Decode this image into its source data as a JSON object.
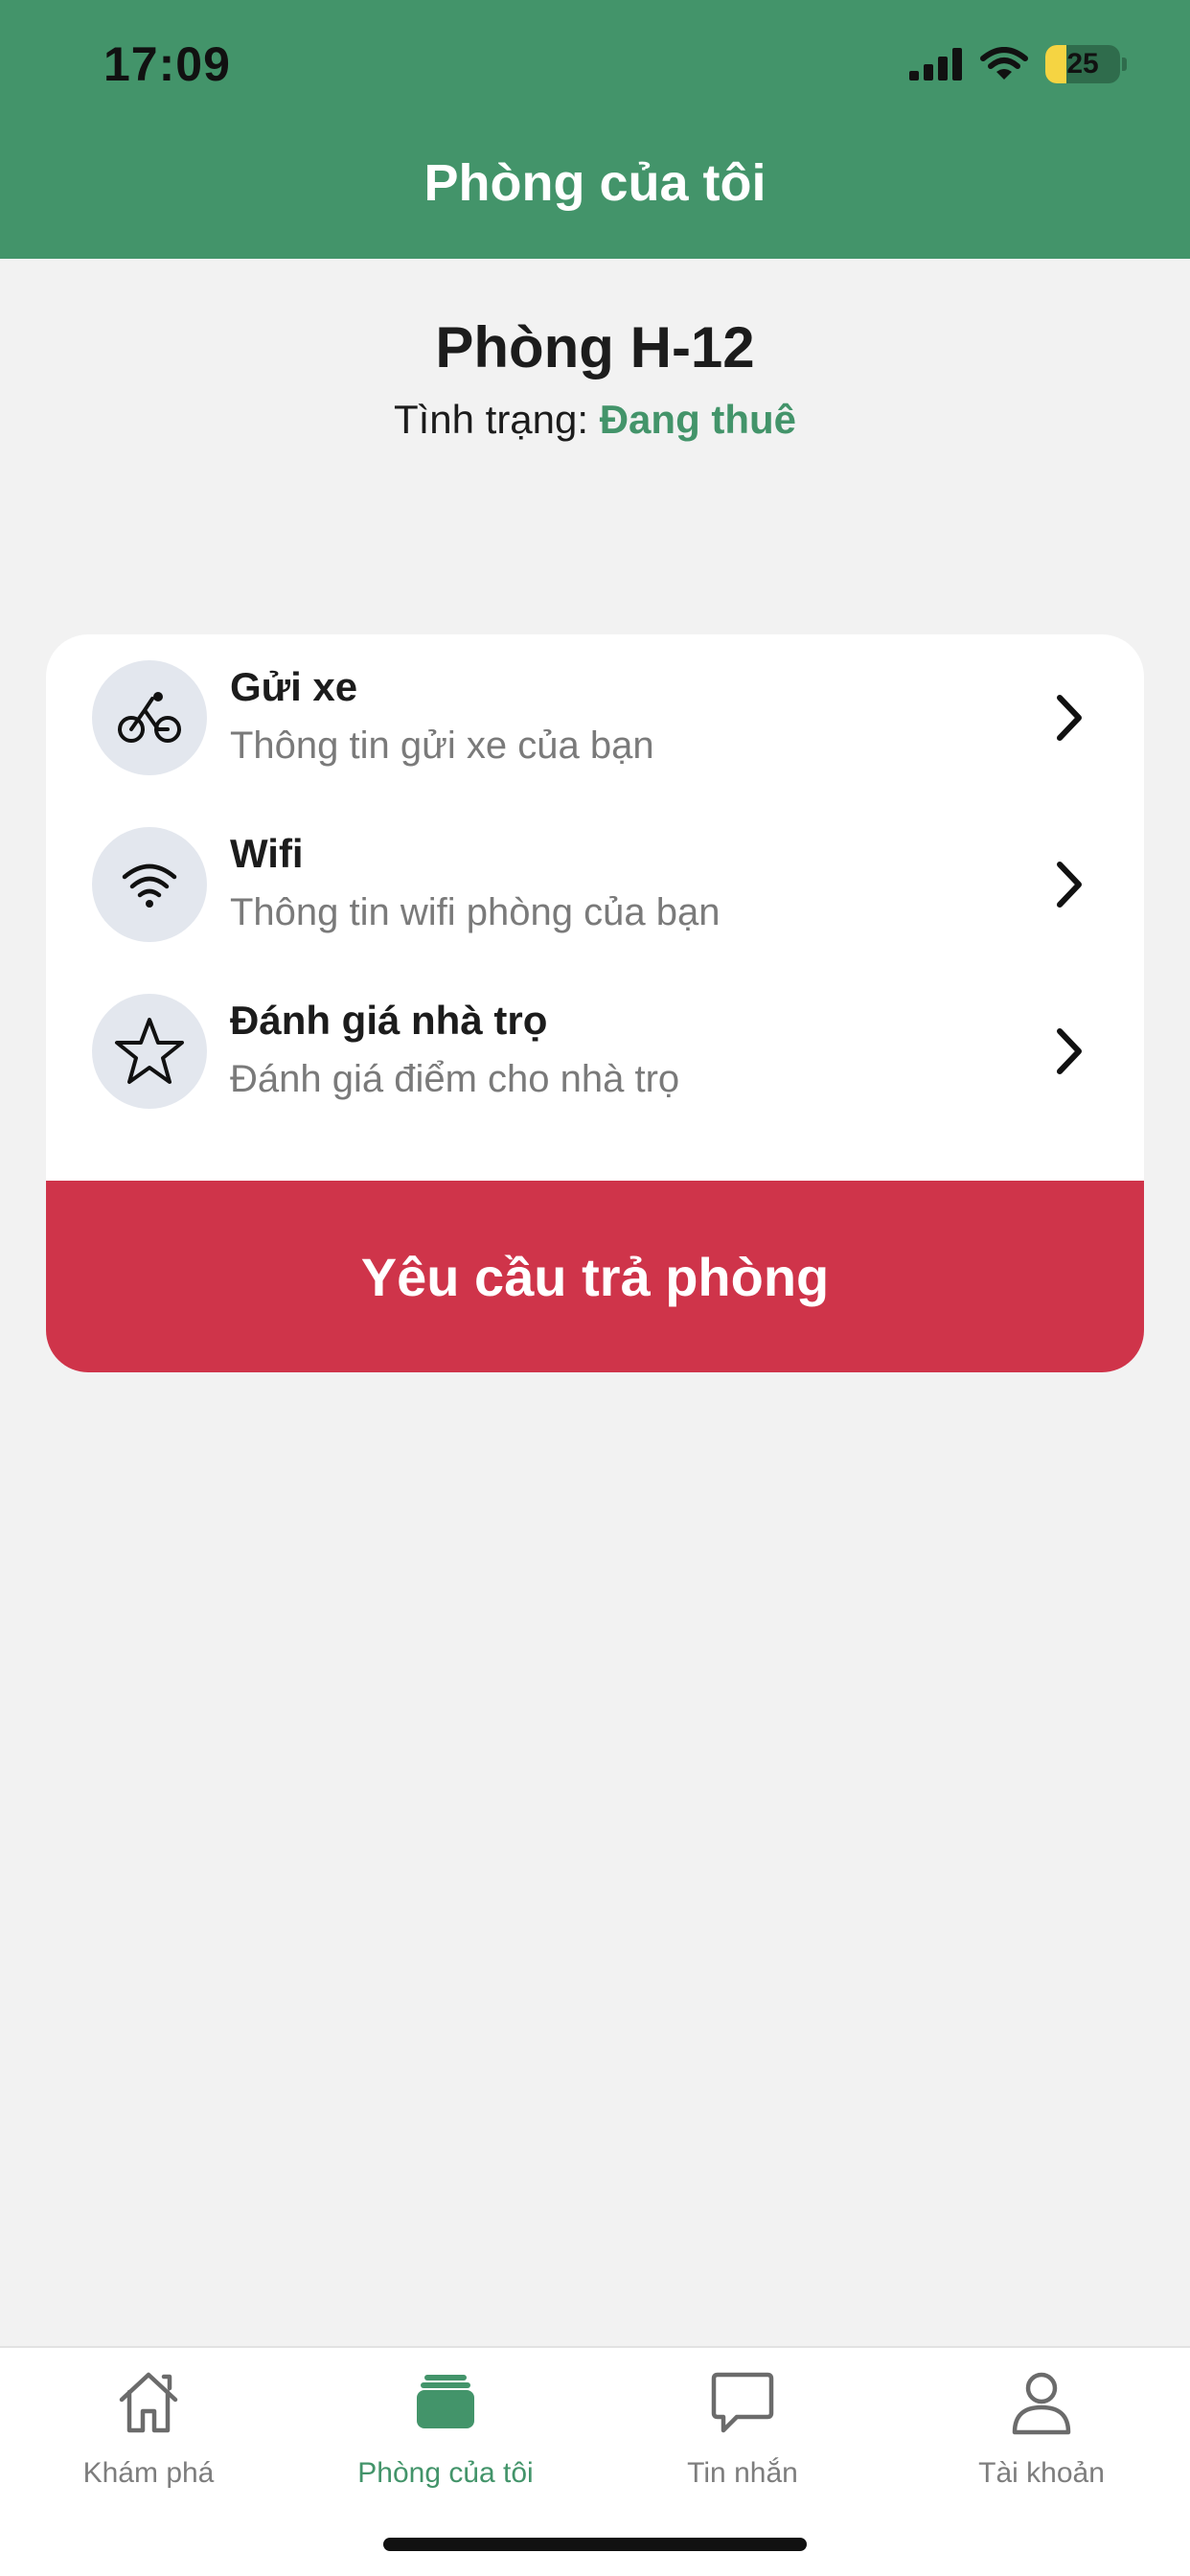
{
  "status_bar": {
    "time": "17:09",
    "battery": "25"
  },
  "header": {
    "title": "Phòng của tôi"
  },
  "room": {
    "title": "Phòng H-12",
    "status_label": "Tình trạng:",
    "status_value": "Đang thuê"
  },
  "menu": {
    "items": [
      {
        "title": "Gửi xe",
        "subtitle": "Thông tin gửi xe của bạn",
        "icon": "bicycle-icon"
      },
      {
        "title": "Wifi",
        "subtitle": "Thông tin wifi phòng của bạn",
        "icon": "wifi-icon"
      },
      {
        "title": "Đánh giá nhà trọ",
        "subtitle": "Đánh giá điểm cho nhà trọ",
        "icon": "star-icon"
      }
    ],
    "checkout_label": "Yêu cầu trả phòng"
  },
  "tabs": [
    {
      "label": "Khám phá",
      "icon": "home-icon"
    },
    {
      "label": "Phòng của tôi",
      "icon": "room-stack-icon",
      "active": true
    },
    {
      "label": "Tin nhắn",
      "icon": "chat-icon"
    },
    {
      "label": "Tài khoản",
      "icon": "user-icon"
    }
  ],
  "colors": {
    "primary": "#43946a",
    "danger": "#cf344a",
    "background": "#f2f2f2",
    "icon_bg": "#e3e7ee"
  }
}
